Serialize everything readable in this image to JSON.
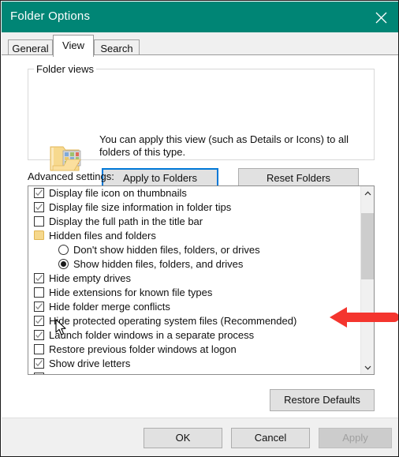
{
  "window": {
    "title": "Folder Options",
    "titlebar_color": "#008575",
    "close_icon": "close-icon"
  },
  "tabs": [
    {
      "label": "General",
      "active": false
    },
    {
      "label": "View",
      "active": true
    },
    {
      "label": "Search",
      "active": false
    }
  ],
  "folder_views": {
    "legend": "Folder views",
    "icon": "folder-thumbnails-icon",
    "description": "You can apply this view (such as Details or Icons) to all folders of this type.",
    "apply_button": "Apply to Folders",
    "reset_button": "Reset Folders",
    "focus_color": "#0078d7"
  },
  "advanced": {
    "label": "Advanced settings:",
    "items": [
      {
        "type": "checkbox",
        "checked": true,
        "indent": false,
        "label": "Display file icon on thumbnails"
      },
      {
        "type": "checkbox",
        "checked": true,
        "indent": false,
        "label": "Display file size information in folder tips"
      },
      {
        "type": "checkbox",
        "checked": false,
        "indent": false,
        "label": "Display the full path in the title bar"
      },
      {
        "type": "folder",
        "checked": false,
        "indent": false,
        "label": "Hidden files and folders"
      },
      {
        "type": "radio",
        "checked": false,
        "indent": true,
        "label": "Don't show hidden files, folders, or drives"
      },
      {
        "type": "radio",
        "checked": true,
        "indent": true,
        "label": "Show hidden files, folders, and drives"
      },
      {
        "type": "checkbox",
        "checked": true,
        "indent": false,
        "label": "Hide empty drives"
      },
      {
        "type": "checkbox",
        "checked": false,
        "indent": false,
        "label": "Hide extensions for known file types"
      },
      {
        "type": "checkbox",
        "checked": true,
        "indent": false,
        "label": "Hide folder merge conflicts"
      },
      {
        "type": "checkbox",
        "checked": true,
        "indent": false,
        "label": "Hide protected operating system files (Recommended)"
      },
      {
        "type": "checkbox",
        "checked": true,
        "indent": false,
        "label": "Launch folder windows in a separate process"
      },
      {
        "type": "checkbox",
        "checked": false,
        "indent": false,
        "label": "Restore previous folder windows at logon"
      },
      {
        "type": "checkbox",
        "checked": true,
        "indent": false,
        "label": "Show drive letters"
      },
      {
        "type": "checkbox",
        "checked": false,
        "indent": false,
        "label": ""
      }
    ],
    "scrollbar": {
      "up_icon": "chevron-up-icon",
      "down_icon": "chevron-down-icon",
      "thumb": "scrollbar-thumb"
    }
  },
  "restore_defaults_button": "Restore Defaults",
  "footer": {
    "ok": "OK",
    "cancel": "Cancel",
    "apply": "Apply",
    "apply_disabled": true
  },
  "annotation": {
    "arrow_icon": "red-arrow-pointing-left",
    "arrow_color": "#f4352e"
  },
  "cursor": {
    "icon": "mouse-pointer-cursor"
  }
}
